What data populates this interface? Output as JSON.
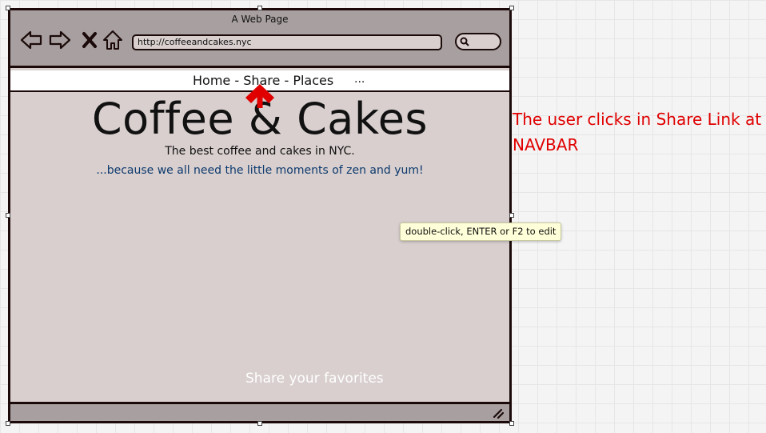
{
  "window": {
    "title": "A Web Page"
  },
  "toolbar": {
    "back_icon": "back-arrow-icon",
    "forward_icon": "forward-arrow-icon",
    "stop_icon": "close-icon",
    "home_icon": "home-icon",
    "url": "http://coffeeandcakes.nyc",
    "search_icon": "search-icon"
  },
  "navbar": {
    "links": [
      "Home",
      "Share",
      "Places"
    ],
    "separator": " - ",
    "more": "..."
  },
  "content": {
    "title": "Coffee & Cakes",
    "tagline": "The best coffee and cakes in NYC.",
    "subline": "...because we all need the little moments of zen and yum!",
    "share_text": "Share your favorites"
  },
  "annotation": {
    "text": "The user clicks in Share Link at NAVBAR"
  },
  "tooltip": {
    "text": "double-click, ENTER or F2 to edit"
  },
  "colors": {
    "annotation": "#e00000",
    "subline": "#0e3a6e",
    "frame": "#1c0a0a",
    "chrome": "#a8a0a0",
    "content_bg": "#d8cfce",
    "arrow": "#e00000"
  }
}
